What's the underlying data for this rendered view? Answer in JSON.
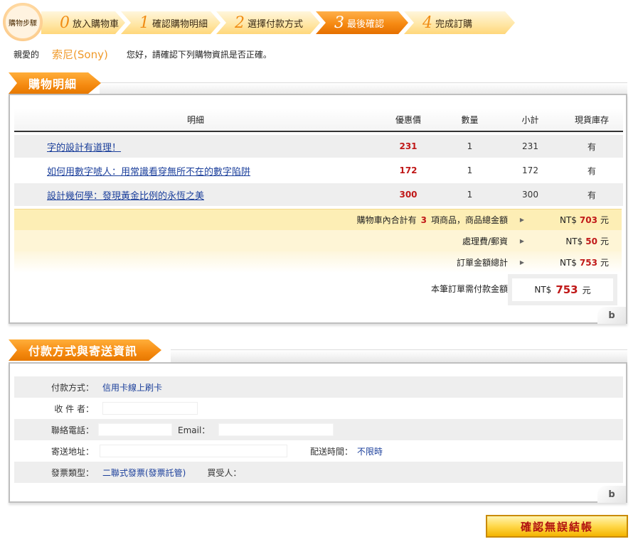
{
  "steps": {
    "title": "購物步驟",
    "items": [
      {
        "num": "0",
        "label": "放入購物車"
      },
      {
        "num": "1",
        "label": "確認購物明細"
      },
      {
        "num": "2",
        "label": "選擇付款方式"
      },
      {
        "num": "3",
        "label": "最後確認"
      },
      {
        "num": "4",
        "label": "完成訂購"
      }
    ],
    "active_index": 3
  },
  "greeting": {
    "prefix": "親愛的",
    "name": "索尼(Sony)",
    "message": "您好，請確認下列購物資訊是否正確。"
  },
  "cart": {
    "section_title": "購物明細",
    "headers": {
      "detail": "明細",
      "price": "優惠價",
      "qty": "數量",
      "subtotal": "小計",
      "stock": "現貨庫存"
    },
    "items": [
      {
        "title": "字的設計有道理！",
        "price": "231",
        "qty": "1",
        "subtotal": "231",
        "stock": "有"
      },
      {
        "title": "如何用數字唬人：用常識看穿無所不在的數字陷阱",
        "price": "172",
        "qty": "1",
        "subtotal": "172",
        "stock": "有"
      },
      {
        "title": "設計幾何學：發現黃金比例的永恆之美",
        "price": "300",
        "qty": "1",
        "subtotal": "300",
        "stock": "有"
      }
    ],
    "summary": {
      "count_prefix": "購物車內合計有",
      "count": "3",
      "count_suffix": "項商品，商品總金額",
      "goods_total": "703",
      "shipping_label": "處理費/郵資",
      "shipping": "50",
      "order_total_label": "訂單金額總計",
      "order_total": "753",
      "currency": "NT$",
      "unit": "元",
      "pay_label": "本筆訂單需付款金額",
      "pay_amount": "753"
    },
    "logo": "b"
  },
  "payment": {
    "section_title": "付款方式與寄送資訊",
    "method_label": "付款方式：",
    "method_value": "信用卡線上刷卡",
    "receiver_label": "收 件 者：",
    "phone_label": "聯絡電話：",
    "email_label": "Email：",
    "address_label": "寄送地址：",
    "delivery_time_label": "配送時間：",
    "delivery_time_value": "不限時",
    "invoice_label": "發票類型：",
    "invoice_value": "二聯式發票(發票託管)",
    "buyer_label": "買受人：",
    "logo": "b"
  },
  "confirm_button": "確認無誤結帳",
  "colors": {
    "accent": "#f58a10",
    "price": "#c01818",
    "link": "#1b3f9b",
    "highlight": "#fdeeb5"
  }
}
